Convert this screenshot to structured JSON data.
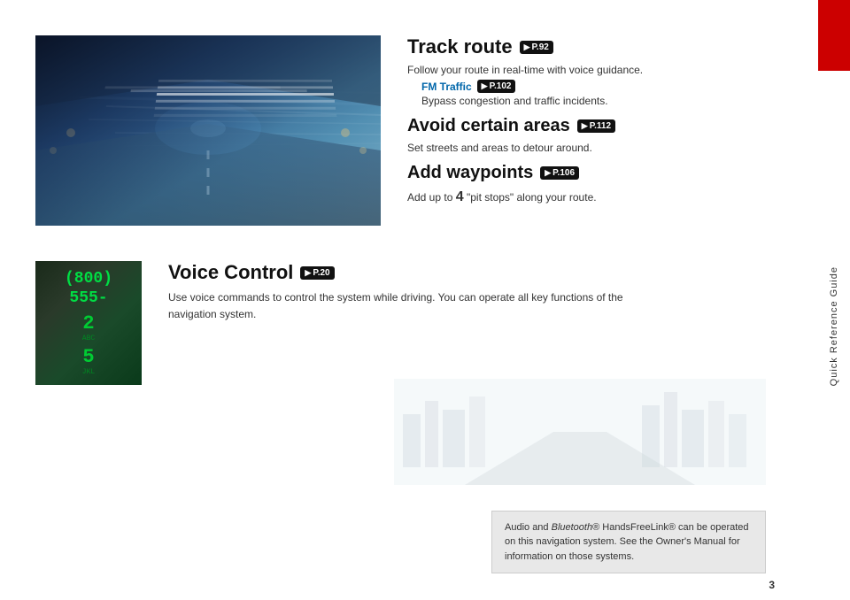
{
  "page": {
    "number": "3",
    "side_tab_label": "Quick Reference Guide"
  },
  "track_route": {
    "title": "Track route",
    "page_ref": "P.92",
    "description": "Follow your route in real-time with voice guidance.",
    "fm_traffic": {
      "label": "FM Traffic",
      "page_ref": "P.102"
    },
    "bypass_text": "Bypass congestion and traffic incidents."
  },
  "avoid_areas": {
    "title": "Avoid certain areas",
    "page_ref": "P.112",
    "description": "Set streets and areas to detour around."
  },
  "add_waypoints": {
    "title": "Add waypoints",
    "page_ref": "P.106",
    "description_pre": "Add up to",
    "number": "4",
    "description_post": "\"pit stops\" along your route."
  },
  "voice_control": {
    "title": "Voice Control",
    "page_ref": "P.20",
    "description": "Use voice commands to control the system while driving. You can operate all key functions of the navigation system.",
    "phone_display_top": "(800) 555-",
    "phone_key1": "2",
    "phone_key1_label": "ABC",
    "phone_key2": "5",
    "phone_key2_label": "JKL"
  },
  "note_box": {
    "text": "Audio and Bluetooth® HandsFreeLink® can be operated on this navigation system. See the Owner's Manual for information on those systems.",
    "bluetooth_label": "Bluetooth"
  }
}
